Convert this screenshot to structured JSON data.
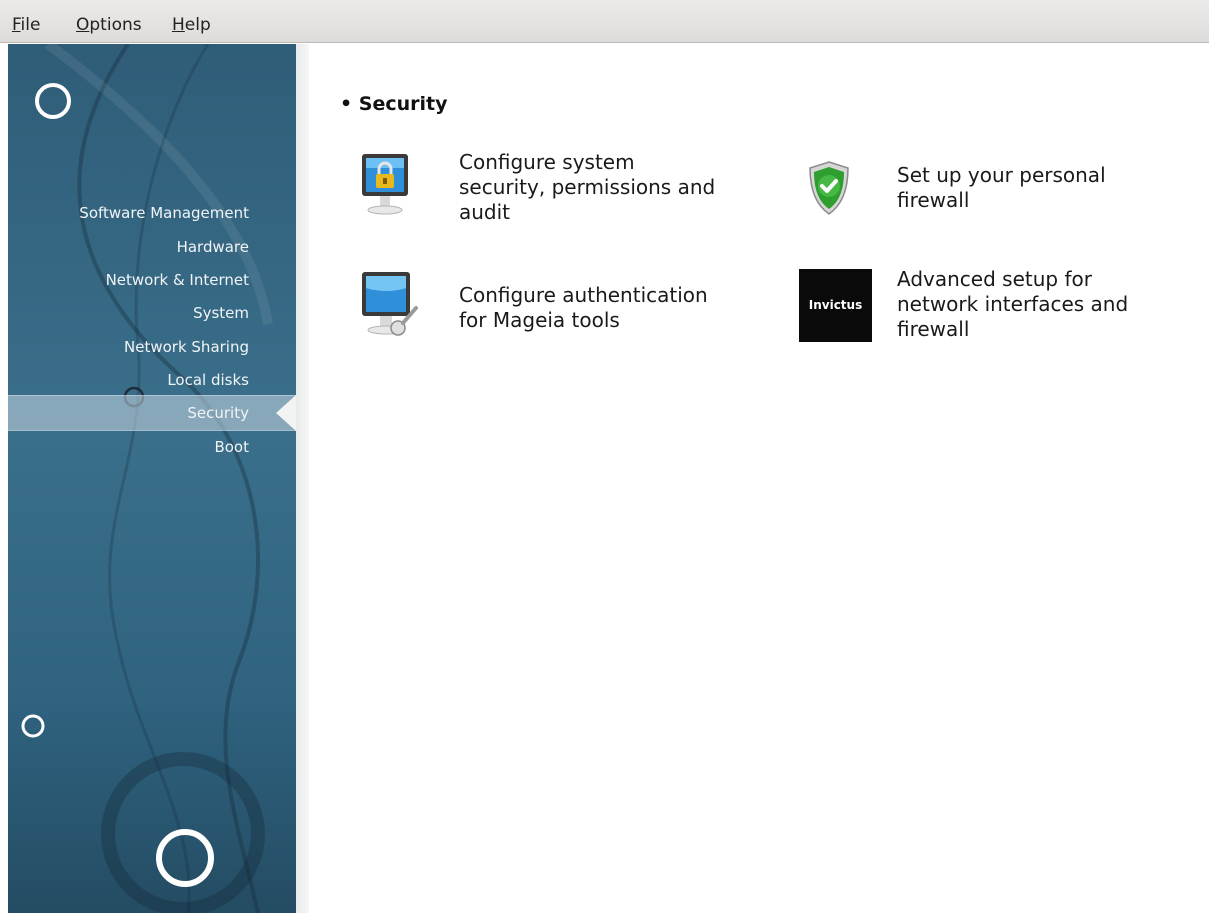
{
  "menubar": {
    "file": {
      "acc": "F",
      "rest": "ile"
    },
    "options": {
      "acc": "O",
      "rest": "ptions"
    },
    "help": {
      "acc": "H",
      "rest": "elp"
    }
  },
  "sidebar": {
    "items": [
      {
        "label": "Software Management"
      },
      {
        "label": "Hardware"
      },
      {
        "label": "Network & Internet"
      },
      {
        "label": "System"
      },
      {
        "label": "Network Sharing"
      },
      {
        "label": "Local disks"
      },
      {
        "label": "Security",
        "selected": true
      },
      {
        "label": "Boot"
      }
    ]
  },
  "main": {
    "section_title": "• Security",
    "tools": [
      {
        "icon": "monitor-lock-icon",
        "line1": "Configure system",
        "line2": "security, permissions and",
        "line3": "audit"
      },
      {
        "icon": "shield-check-icon",
        "line1": "Set up your personal",
        "line2": "firewall"
      },
      {
        "icon": "monitor-key-icon",
        "line1": "Configure authentication",
        "line2": "for Mageia tools"
      },
      {
        "icon": "invictus-icon",
        "icon_text": "Invictus",
        "line1": "Advanced setup for",
        "line2": "network interfaces and",
        "line3": "firewall"
      }
    ]
  },
  "colors": {
    "sidebar_top": "#2f5d78",
    "sidebar_mid": "#3a6f8b",
    "sidebar_bottom": "#244c63",
    "shield_green": "#2e9e2e"
  }
}
